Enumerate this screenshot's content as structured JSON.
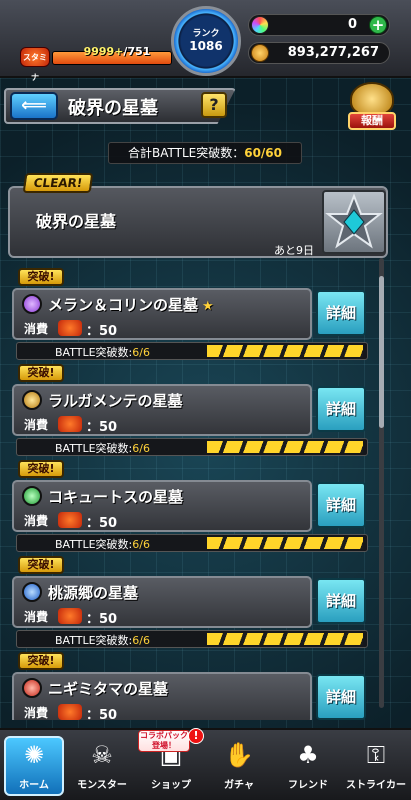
{
  "status": {
    "stamina_icon": "スタミナ",
    "stamina_current": "9999+",
    "stamina_max": "/751",
    "rank_label": "ランク",
    "rank_value": "1086",
    "orbs": "0",
    "coins": "893,277,267"
  },
  "header": {
    "title": "破界の星墓",
    "help": "?",
    "reward_label": "報酬"
  },
  "total_battle": {
    "label": "合計BATTLE突破数：",
    "value": "60/60"
  },
  "main_panel": {
    "clear_tag": "CLEAR!",
    "title": "破界の星墓",
    "days_left": "あと9日"
  },
  "stages": [
    {
      "tag": "突破!",
      "name": "メラン＆コリンの星墓",
      "star": "★",
      "cost_label": "消費",
      "cost": "：50",
      "battle_label": "BATTLE突破数:",
      "battle_value": "6/6",
      "detail": "詳細",
      "element_color": "#8b3bd6"
    },
    {
      "tag": "突破!",
      "name": "ラルガメンテの星墓",
      "star": "",
      "cost_label": "消費",
      "cost": "：50",
      "battle_label": "BATTLE突破数:",
      "battle_value": "6/6",
      "detail": "詳細",
      "element_color": "#e0a21f"
    },
    {
      "tag": "突破!",
      "name": "コキュートスの星墓",
      "star": "",
      "cost_label": "消費",
      "cost": "：50",
      "battle_label": "BATTLE突破数:",
      "battle_value": "6/6",
      "detail": "詳細",
      "element_color": "#2fbf45"
    },
    {
      "tag": "突破!",
      "name": "桃源郷の星墓",
      "star": "",
      "cost_label": "消費",
      "cost": "：50",
      "battle_label": "BATTLE突破数:",
      "battle_value": "6/6",
      "detail": "詳細",
      "element_color": "#2f73d8"
    },
    {
      "tag": "突破!",
      "name": "ニギミタマの星墓",
      "star": "",
      "cost_label": "消費",
      "cost": "：50",
      "detail": "詳細",
      "element_color": "#d8342a"
    }
  ],
  "nav": {
    "home": "ホーム",
    "monster": "モンスター",
    "shop": "ショップ",
    "gacha": "ガチャ",
    "friend": "フレンド",
    "striker": "ストライカー",
    "collab_badge": "コラボパック 登場！",
    "alert": "!"
  }
}
